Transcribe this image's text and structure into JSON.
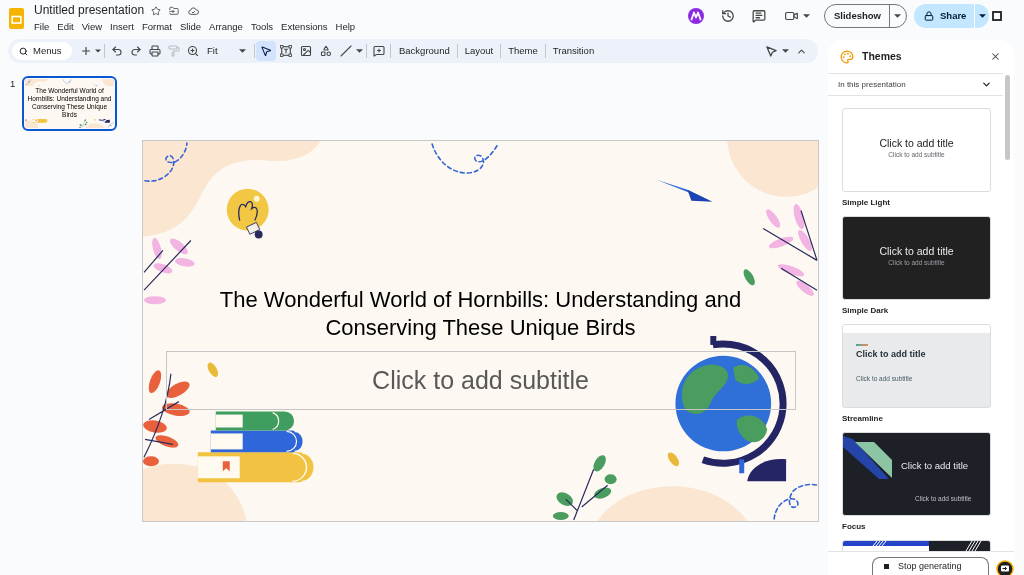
{
  "header": {
    "title": "Untitled presentation",
    "menu": [
      "File",
      "Edit",
      "View",
      "Insert",
      "Format",
      "Slide",
      "Arrange",
      "Tools",
      "Extensions",
      "Help"
    ],
    "slideshow": "Slideshow",
    "share": "Share"
  },
  "toolbar": {
    "search": {
      "placeholder": "Menus"
    },
    "edit_tools": [
      {
        "disabled": false
      },
      {
        "disabled": false
      },
      {
        "disabled": false
      },
      {
        "disabled": true
      }
    ],
    "zoom": "Fit",
    "insert_tools": [
      {
        "selected": true
      },
      {
        "selected": false
      },
      {
        "selected": false
      },
      {
        "selected": false
      },
      {
        "selected": false
      }
    ],
    "actions": [
      "Background",
      "Layout",
      "Theme",
      "Transition"
    ]
  },
  "filmstrip": [
    {
      "number": "1",
      "title": "The Wonderful World of Hornbills: Understanding and Conserving These Unique Birds",
      "selected": true
    }
  ],
  "slide": {
    "title": "The Wonderful World of Hornbills: Understanding and Conserving These Unique Birds",
    "subtitle": {
      "placeholder": "Click to add subtitle"
    }
  },
  "themes_panel": {
    "title": "Themes",
    "filter": "In this presentation",
    "themes": [
      {
        "kind": "light",
        "name": "Simple Light",
        "preview_title": "Click to add title",
        "preview_subtitle": "Click to add subtitle"
      },
      {
        "kind": "dark",
        "name": "Simple Dark",
        "preview_title": "Click to add title",
        "preview_subtitle": "Click to add subtitle"
      },
      {
        "kind": "streamline",
        "name": "Streamline",
        "preview_title": "Click to add title",
        "preview_subtitle": "Click to add subtitle"
      },
      {
        "kind": "focus",
        "name": "Focus",
        "preview_title": "Click to add title",
        "preview_subtitle": "Click to add subtitle"
      },
      {
        "kind": "stripes"
      }
    ],
    "stop_button": "Stop generating"
  }
}
